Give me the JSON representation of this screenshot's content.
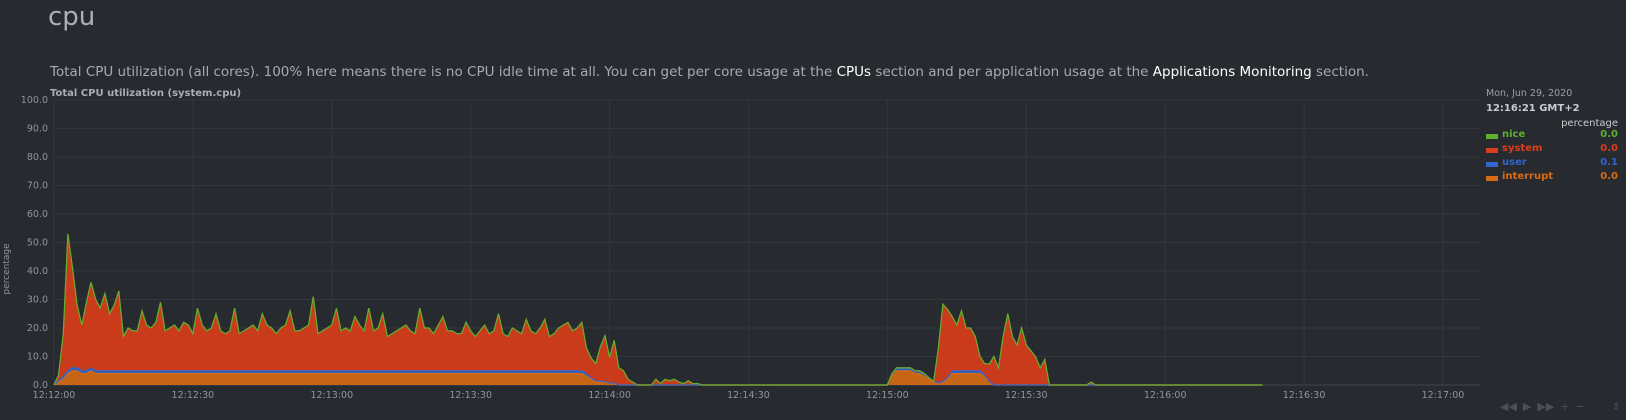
{
  "section": {
    "title": "cpu",
    "description": {
      "part1": "Total CPU utilization (all cores). 100% here means there is no CPU idle time at all. You can get per core usage at the ",
      "link1": "CPUs",
      "part2": " section and per application usage at the ",
      "link2": "Applications Monitoring",
      "part3": " section."
    }
  },
  "chart_title": "Total CPU utilization (system.cpu)",
  "legend": {
    "date": "Mon, Jun 29, 2020",
    "time": "12:16:21 GMT+2",
    "units": "percentage",
    "items": [
      {
        "name": "nice",
        "value": "0.0",
        "color": "#5db12f"
      },
      {
        "name": "system",
        "value": "0.0",
        "color": "#dd3d1b"
      },
      {
        "name": "user",
        "value": "0.1",
        "color": "#3366cc"
      },
      {
        "name": "interrupt",
        "value": "0.0",
        "color": "#d86c14"
      }
    ]
  },
  "controls": {
    "left": "◀◀",
    "play": "▶",
    "right": "▶▶",
    "zoom_in": "+",
    "zoom_out": "−",
    "resize": "⇕"
  },
  "chart_data": {
    "type": "area",
    "stacked": true,
    "ylabel": "percentage",
    "ylim": [
      0,
      100
    ],
    "yticks": [
      "0.0",
      "10.0",
      "20.0",
      "30.0",
      "40.0",
      "50.0",
      "60.0",
      "70.0",
      "80.0",
      "90.0",
      "100.0"
    ],
    "xlim_seconds_from_start": [
      0,
      308
    ],
    "xticks": [
      {
        "t": 0,
        "label": "12:12:00"
      },
      {
        "t": 30,
        "label": "12:12:30"
      },
      {
        "t": 60,
        "label": "12:13:00"
      },
      {
        "t": 90,
        "label": "12:13:30"
      },
      {
        "t": 120,
        "label": "12:14:00"
      },
      {
        "t": 150,
        "label": "12:14:30"
      },
      {
        "t": 180,
        "label": "12:15:00"
      },
      {
        "t": 210,
        "label": "12:15:30"
      },
      {
        "t": 240,
        "label": "12:16:00"
      },
      {
        "t": 270,
        "label": "12:16:30"
      },
      {
        "t": 300,
        "label": "12:17:00"
      }
    ],
    "x": [
      0,
      1,
      2,
      3,
      4,
      5,
      6,
      7,
      8,
      9,
      10,
      11,
      12,
      13,
      14,
      15,
      16,
      17,
      18,
      19,
      20,
      21,
      22,
      23,
      24,
      25,
      26,
      27,
      28,
      29,
      30,
      31,
      32,
      33,
      34,
      35,
      36,
      37,
      38,
      39,
      40,
      41,
      42,
      43,
      44,
      45,
      46,
      47,
      48,
      49,
      50,
      51,
      52,
      53,
      54,
      55,
      56,
      57,
      58,
      59,
      60,
      61,
      62,
      63,
      64,
      65,
      66,
      67,
      68,
      69,
      70,
      71,
      72,
      73,
      74,
      75,
      76,
      77,
      78,
      79,
      80,
      81,
      82,
      83,
      84,
      85,
      86,
      87,
      88,
      89,
      90,
      91,
      92,
      93,
      94,
      95,
      96,
      97,
      98,
      99,
      100,
      101,
      102,
      103,
      104,
      105,
      106,
      107,
      108,
      109,
      110,
      111,
      112,
      113,
      114,
      115,
      116,
      117,
      118,
      119,
      120,
      121,
      122,
      123,
      124,
      125,
      126,
      127,
      128,
      129,
      130,
      131,
      132,
      133,
      134,
      135,
      136,
      137,
      138,
      139,
      140,
      141,
      142,
      143,
      144,
      145,
      146,
      147,
      148,
      149,
      150,
      151,
      152,
      153,
      154,
      155,
      156,
      157,
      158,
      159,
      160,
      161,
      162,
      163,
      164,
      165,
      166,
      167,
      168,
      169,
      170,
      171,
      172,
      173,
      174,
      175,
      176,
      177,
      178,
      179,
      180,
      181,
      182,
      183,
      184,
      185,
      186,
      187,
      188,
      189,
      190,
      191,
      192,
      193,
      194,
      195,
      196,
      197,
      198,
      199,
      200,
      201,
      202,
      203,
      204,
      205,
      206,
      207,
      208,
      209,
      210,
      211,
      212,
      213,
      214,
      215,
      216,
      217,
      218,
      219,
      220,
      221,
      222,
      223,
      224,
      225,
      226,
      227,
      228,
      229,
      230,
      231,
      232,
      233,
      234,
      235,
      236,
      237,
      238,
      239,
      240,
      241,
      242,
      243,
      244,
      245,
      246,
      247,
      248,
      249,
      250,
      251,
      252,
      253,
      254,
      255,
      256,
      257,
      258,
      259,
      260,
      261
    ],
    "series": [
      {
        "name": "interrupt",
        "values": [
          0,
          1,
          2,
          4,
          5,
          5,
          4,
          4,
          5,
          4,
          4,
          4,
          4,
          4,
          4,
          4,
          4,
          4,
          4,
          4,
          4,
          4,
          4,
          4,
          4,
          4,
          4,
          4,
          4,
          4,
          4,
          4,
          4,
          4,
          4,
          4,
          4,
          4,
          4,
          4,
          4,
          4,
          4,
          4,
          4,
          4,
          4,
          4,
          4,
          4,
          4,
          4,
          4,
          4,
          4,
          4,
          4,
          4,
          4,
          4,
          4,
          4,
          4,
          4,
          4,
          4,
          4,
          4,
          4,
          4,
          4,
          4,
          4,
          4,
          4,
          4,
          4,
          4,
          4,
          4,
          4,
          4,
          4,
          4,
          4,
          4,
          4,
          4,
          4,
          4,
          4,
          4,
          4,
          4,
          4,
          4,
          4,
          4,
          4,
          4,
          4,
          4,
          4,
          4,
          4,
          4,
          4,
          4,
          4,
          4,
          4,
          4,
          4,
          4,
          4,
          3,
          2,
          1,
          1,
          1,
          0.5,
          0.5,
          0,
          0,
          0,
          0,
          0,
          0,
          0,
          0,
          0,
          0,
          0,
          0,
          0,
          0,
          0,
          0,
          0,
          0,
          0,
          0,
          0,
          0,
          0,
          0,
          0,
          0,
          0,
          0,
          0,
          0,
          0,
          0,
          0,
          0,
          0,
          0,
          0,
          0,
          0,
          0,
          0,
          0,
          0,
          0,
          0,
          0,
          0,
          0,
          0,
          0,
          0,
          0,
          0,
          0,
          0,
          0,
          0,
          0,
          0,
          3,
          5,
          5,
          5,
          5,
          4,
          4,
          3,
          2,
          1,
          0.5,
          1,
          2,
          4,
          4,
          4,
          4,
          4,
          4,
          4,
          3,
          1,
          0,
          0,
          0,
          0,
          0,
          0,
          0,
          0,
          0,
          0,
          0,
          0,
          0,
          0,
          0,
          0,
          0,
          0,
          0,
          0,
          0,
          0,
          0,
          0,
          0,
          0,
          0,
          0,
          0,
          0,
          0,
          0,
          0,
          0,
          0,
          0,
          0,
          0,
          0,
          0,
          0,
          0,
          0,
          0,
          0,
          0,
          0,
          0,
          0,
          0,
          0,
          0,
          0,
          0,
          0,
          0,
          0,
          0,
          0,
          0,
          0,
          0,
          0,
          0,
          0,
          0
        ]
      },
      {
        "name": "user",
        "values": [
          0,
          0.5,
          1,
          1,
          1,
          1,
          1,
          1,
          1,
          1,
          1,
          1,
          1,
          1,
          1,
          1,
          1,
          1,
          1,
          1,
          1,
          1,
          1,
          1,
          1,
          1,
          1,
          1,
          1,
          1,
          1,
          1,
          1,
          1,
          1,
          1,
          1,
          1,
          1,
          1,
          1,
          1,
          1,
          1,
          1,
          1,
          1,
          1,
          1,
          1,
          1,
          1,
          1,
          1,
          1,
          1,
          1,
          1,
          1,
          1,
          1,
          1,
          1,
          1,
          1,
          1,
          1,
          1,
          1,
          1,
          1,
          1,
          1,
          1,
          1,
          1,
          1,
          1,
          1,
          1,
          1,
          1,
          1,
          1,
          1,
          1,
          1,
          1,
          1,
          1,
          1,
          1,
          1,
          1,
          1,
          1,
          1,
          1,
          1,
          1,
          1,
          1,
          1,
          1,
          1,
          1,
          1,
          1,
          1,
          1,
          1,
          1,
          1,
          1,
          1,
          1,
          0.5,
          0.5,
          0.3,
          0.3,
          0.2,
          0.2,
          0,
          0,
          0,
          0,
          0,
          0,
          0,
          0,
          0,
          0,
          0,
          0,
          0,
          0,
          0,
          0,
          0,
          0,
          0,
          0,
          0,
          0,
          0,
          0,
          0,
          0,
          0,
          0,
          0,
          0,
          0,
          0,
          0,
          0,
          0,
          0,
          0,
          0,
          0,
          0,
          0,
          0,
          0,
          0,
          0,
          0,
          0,
          0,
          0,
          0,
          0,
          0,
          0,
          0,
          0,
          0,
          0,
          0,
          0,
          1,
          1,
          1,
          1,
          1,
          1,
          1,
          1,
          0.5,
          0.3,
          0.2,
          0.3,
          0.5,
          1,
          1,
          1,
          1,
          1,
          1,
          1,
          0.5,
          0.3,
          0,
          0,
          0,
          0,
          0,
          0,
          0,
          0,
          0,
          0,
          0,
          0,
          0,
          0,
          0,
          0,
          0,
          0,
          0,
          0,
          0,
          0,
          0,
          0,
          0,
          0,
          0,
          0,
          0,
          0,
          0,
          0,
          0,
          0,
          0,
          0,
          0,
          0,
          0,
          0,
          0,
          0,
          0,
          0,
          0,
          0,
          0,
          0,
          0,
          0,
          0,
          0,
          0,
          0,
          0,
          0,
          0,
          0,
          0,
          0,
          0,
          0,
          0,
          0,
          0
        ]
      },
      {
        "name": "system",
        "values": [
          0,
          2,
          15,
          48,
          35,
          22,
          16,
          24,
          30,
          25,
          22,
          27,
          20,
          23,
          28,
          12,
          15,
          14,
          14,
          21,
          16,
          15,
          17,
          24,
          14,
          15,
          16,
          14,
          17,
          16,
          13,
          22,
          16,
          14,
          15,
          20,
          14,
          13,
          14,
          22,
          13,
          14,
          15,
          16,
          14,
          20,
          16,
          15,
          13,
          15,
          16,
          21,
          14,
          14,
          15,
          16,
          26,
          13,
          14,
          15,
          16,
          22,
          14,
          15,
          14,
          19,
          16,
          14,
          22,
          14,
          15,
          20,
          12,
          13,
          14,
          15,
          16,
          14,
          13,
          22,
          15,
          15,
          13,
          16,
          19,
          14,
          14,
          13,
          13,
          17,
          14,
          12,
          14,
          16,
          13,
          14,
          20,
          13,
          12,
          15,
          14,
          13,
          18,
          14,
          13,
          15,
          18,
          12,
          13,
          15,
          16,
          17,
          14,
          15,
          17,
          9,
          7,
          6,
          12,
          16,
          9,
          15,
          6,
          5,
          2,
          1,
          0,
          0,
          0,
          0,
          2,
          0.5,
          2,
          1.5,
          2,
          1,
          0.5,
          1.5,
          0.5,
          0.5,
          0,
          0,
          0,
          0,
          0,
          0,
          0,
          0,
          0,
          0,
          0,
          0,
          0,
          0,
          0,
          0,
          0,
          0,
          0,
          0,
          0,
          0,
          0,
          0,
          0,
          0,
          0,
          0,
          0,
          0,
          0,
          0,
          0,
          0,
          0,
          0,
          0,
          0,
          0,
          0,
          0,
          0,
          0,
          0,
          0,
          0,
          0,
          0,
          0,
          0,
          0,
          12,
          27,
          24,
          19,
          16,
          21,
          15,
          15,
          12,
          5,
          4,
          6,
          10,
          6,
          17,
          25,
          17,
          14,
          20,
          14,
          12,
          10,
          6,
          9,
          0,
          0,
          0,
          0,
          0,
          0,
          0,
          0,
          0,
          1,
          0,
          0,
          0,
          0,
          0,
          0,
          0,
          0,
          0,
          0,
          0,
          0,
          0,
          0,
          0,
          0,
          0,
          0,
          0,
          0,
          0,
          0,
          0,
          0,
          0,
          0,
          0,
          0,
          0,
          0,
          0,
          0,
          0,
          0,
          0,
          0,
          0,
          0,
          0,
          0,
          0,
          0,
          0,
          0,
          0,
          0,
          0,
          0,
          0,
          0,
          0,
          0,
          0,
          0,
          0
        ]
      },
      {
        "name": "nice",
        "values": [
          0,
          0,
          0,
          0,
          0,
          0,
          0,
          0,
          0,
          0,
          0,
          0,
          0,
          0,
          0,
          0,
          0,
          0,
          0,
          0,
          0,
          0,
          0,
          0,
          0,
          0,
          0,
          0,
          0,
          0,
          0,
          0,
          0,
          0,
          0,
          0,
          0,
          0,
          0,
          0,
          0,
          0,
          0,
          0,
          0,
          0,
          0,
          0,
          0,
          0,
          0,
          0,
          0,
          0,
          0,
          0,
          0,
          0,
          0,
          0,
          0,
          0,
          0,
          0,
          0,
          0,
          0,
          0,
          0,
          0,
          0,
          0,
          0,
          0,
          0,
          0,
          0,
          0,
          0,
          0,
          0,
          0,
          0,
          0,
          0,
          0,
          0,
          0,
          0,
          0,
          0,
          0,
          0,
          0,
          0,
          0,
          0,
          0,
          0,
          0,
          0,
          0,
          0,
          0,
          0,
          0,
          0,
          0,
          0,
          0,
          0,
          0,
          0,
          0,
          0,
          0,
          0,
          0,
          0,
          0,
          0,
          0,
          0,
          0,
          0,
          0,
          0,
          0,
          0,
          0,
          0,
          0,
          0,
          0,
          0,
          0,
          0,
          0,
          0,
          0,
          0,
          0,
          0,
          0,
          0,
          0,
          0,
          0,
          0,
          0,
          0,
          0,
          0,
          0,
          0,
          0,
          0,
          0,
          0,
          0,
          0,
          0,
          0,
          0,
          0,
          0,
          0,
          0,
          0,
          0,
          0,
          0,
          0,
          0,
          0,
          0,
          0,
          0,
          0,
          0,
          0,
          0,
          0,
          0,
          0,
          0,
          0,
          0,
          0,
          0,
          0,
          0,
          0,
          0,
          0,
          0,
          0,
          0,
          0,
          0,
          0,
          0,
          0,
          0,
          0,
          0,
          0,
          0,
          0,
          0,
          0,
          0,
          0,
          0,
          0,
          0,
          0,
          0,
          0,
          0,
          0,
          0,
          0,
          0,
          0,
          0,
          0,
          0,
          0,
          0,
          0,
          0,
          0,
          0,
          0,
          0,
          0,
          0,
          0,
          0,
          0,
          0,
          0,
          0,
          0,
          0,
          0,
          0,
          0,
          0,
          0,
          0,
          0,
          0,
          0,
          0
        ]
      }
    ]
  }
}
